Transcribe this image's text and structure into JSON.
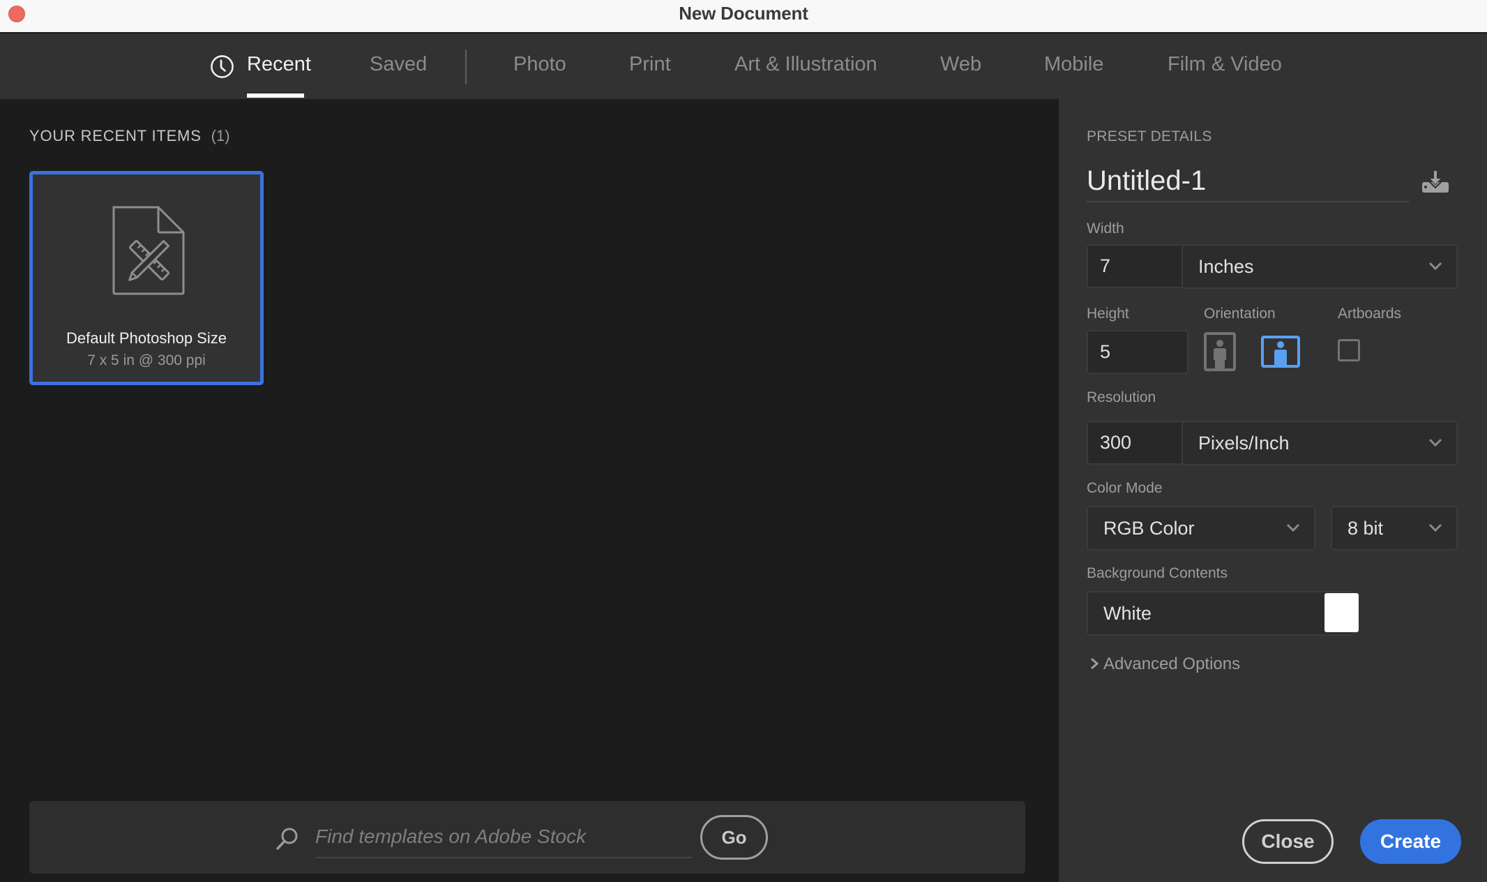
{
  "window": {
    "title": "New Document"
  },
  "tabs": [
    {
      "label": "Recent",
      "active": true,
      "icon": "clock-icon"
    },
    {
      "label": "Saved",
      "active": false
    },
    {
      "label": "Photo",
      "active": false
    },
    {
      "label": "Print",
      "active": false
    },
    {
      "label": "Art & Illustration",
      "active": false
    },
    {
      "label": "Web",
      "active": false
    },
    {
      "label": "Mobile",
      "active": false
    },
    {
      "label": "Film & Video",
      "active": false
    }
  ],
  "recent": {
    "heading": "YOUR RECENT ITEMS",
    "count": "(1)",
    "items": [
      {
        "title": "Default Photoshop Size",
        "subtitle": "7 x 5 in @ 300 ppi",
        "icon": "document-ruler-pencil-icon",
        "selected": true
      }
    ]
  },
  "search": {
    "placeholder": "Find templates on Adobe Stock",
    "value": "",
    "go_label": "Go"
  },
  "preset": {
    "section_label": "PRESET DETAILS",
    "name": "Untitled-1",
    "width_label": "Width",
    "width_value": "7",
    "width_unit": "Inches",
    "height_label": "Height",
    "height_value": "5",
    "orientation_label": "Orientation",
    "orientation_selected": "landscape",
    "artboards_label": "Artboards",
    "artboards_checked": false,
    "resolution_label": "Resolution",
    "resolution_value": "300",
    "resolution_unit": "Pixels/Inch",
    "color_mode_label": "Color Mode",
    "color_mode": "RGB Color",
    "bit_depth": "8 bit",
    "background_label": "Background Contents",
    "background": "White",
    "background_swatch": "#ffffff",
    "advanced_label": "Advanced Options"
  },
  "buttons": {
    "close": "Close",
    "create": "Create"
  },
  "colors": {
    "accent": "#3373e0",
    "selected_orientation": "#5aa0f0",
    "traffic_close": "#ec6a5e"
  }
}
